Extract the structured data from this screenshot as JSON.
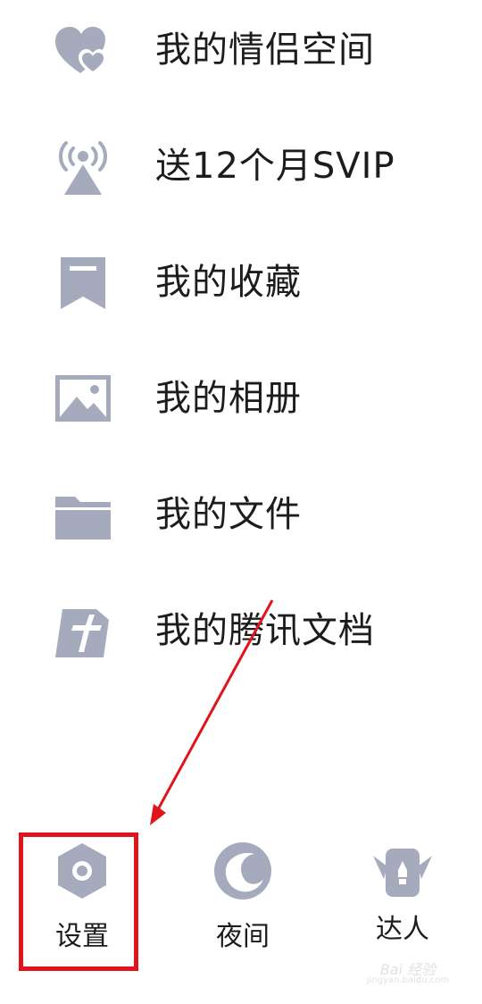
{
  "menu": {
    "items": [
      {
        "label": "我的情侣空间",
        "icon": "hearts-icon"
      },
      {
        "label": "送12个月SVIP",
        "icon": "broadcast-tower-icon"
      },
      {
        "label": "我的收藏",
        "icon": "bookmark-icon"
      },
      {
        "label": "我的相册",
        "icon": "image-icon"
      },
      {
        "label": "我的文件",
        "icon": "folder-icon"
      },
      {
        "label": "我的腾讯文档",
        "icon": "tencent-docs-icon"
      }
    ]
  },
  "bottom": {
    "settings": {
      "label": "设置",
      "icon": "settings-hexagon-icon"
    },
    "night": {
      "label": "夜间",
      "icon": "moon-icon"
    },
    "expert": {
      "label": "达人",
      "icon": "expert-badge-icon"
    }
  },
  "annotation": {
    "highlight_color": "#e0141c"
  },
  "colors": {
    "icon": "#9aa0b4",
    "text": "#1c1c1c"
  },
  "watermark": {
    "text": "Bai 经验",
    "sub": "jingyan.baidu.com"
  }
}
